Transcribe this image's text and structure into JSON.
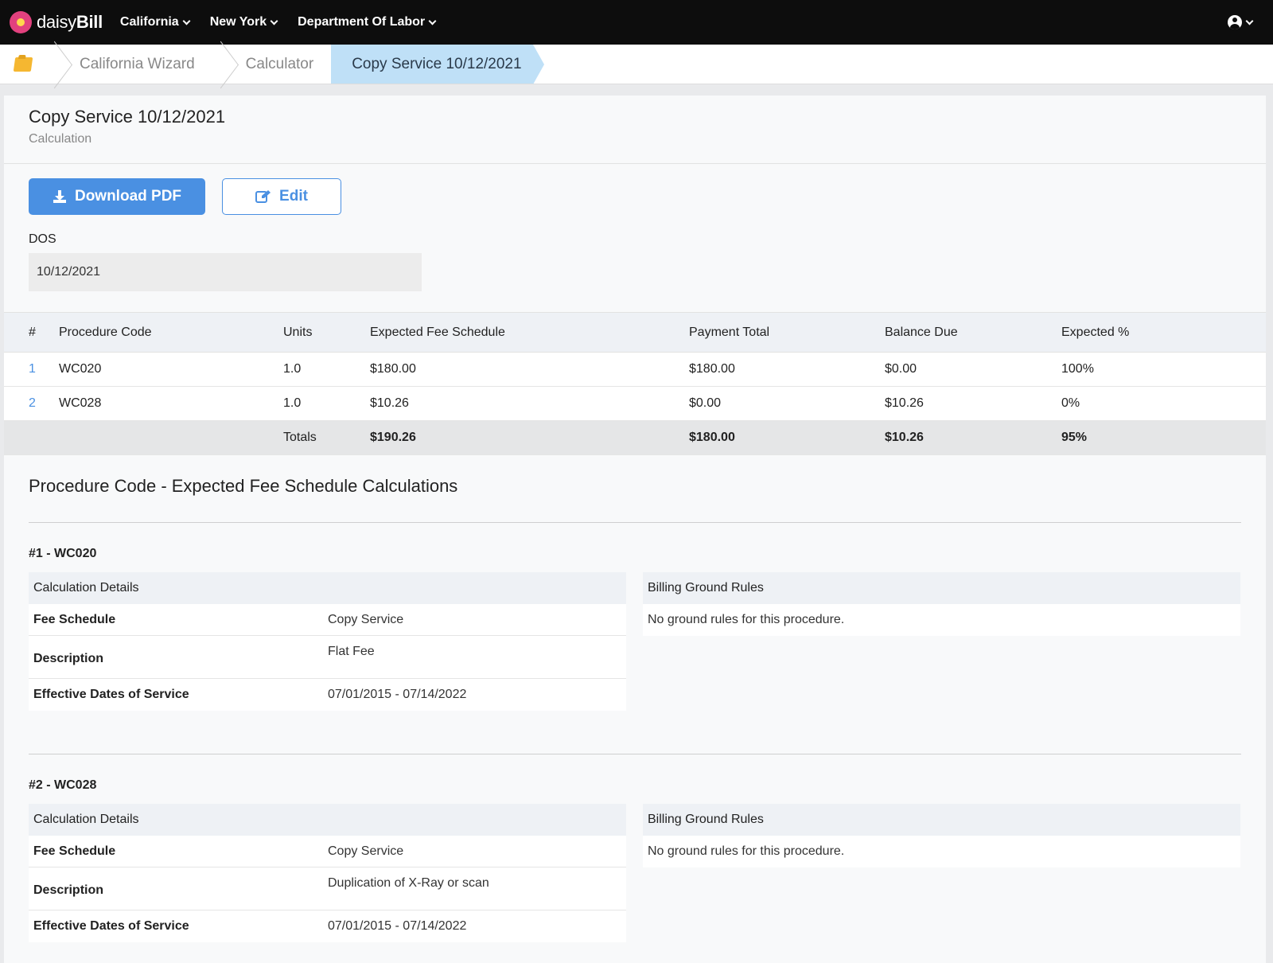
{
  "nav": {
    "logo_prefix": "daisy",
    "logo_bold": "Bill",
    "items": [
      "California",
      "New York",
      "Department Of Labor"
    ]
  },
  "breadcrumb": {
    "items": [
      "California Wizard",
      "Calculator",
      "Copy Service 10/12/2021"
    ]
  },
  "header": {
    "title": "Copy Service 10/12/2021",
    "subtitle": "Calculation"
  },
  "actions": {
    "download_label": "Download PDF",
    "edit_label": "Edit"
  },
  "dos": {
    "label": "DOS",
    "value": "10/12/2021"
  },
  "table": {
    "headers": [
      "#",
      "Procedure Code",
      "Units",
      "Expected Fee Schedule",
      "Payment Total",
      "Balance Due",
      "Expected %"
    ],
    "rows": [
      [
        "1",
        "WC020",
        "1.0",
        "$180.00",
        "$180.00",
        "$0.00",
        "100%"
      ],
      [
        "2",
        "WC028",
        "1.0",
        "$10.26",
        "$0.00",
        "$10.26",
        "0%"
      ]
    ],
    "totals": {
      "label": "Totals",
      "expected": "$190.26",
      "payment": "$180.00",
      "balance": "$10.26",
      "percent": "95%"
    }
  },
  "calc_section": {
    "title": "Procedure Code - Expected Fee Schedule Calculations",
    "details_header": "Calculation Details",
    "rules_header": "Billing Ground Rules",
    "fee_schedule_label": "Fee Schedule",
    "description_label": "Description",
    "effective_label": "Effective Dates of Service",
    "procedures": [
      {
        "title": "#1 - WC020",
        "fee_schedule": "Copy Service",
        "description": "Flat Fee",
        "effective": "07/01/2015 - 07/14/2022",
        "rules": "No ground rules for this procedure."
      },
      {
        "title": "#2 - WC028",
        "fee_schedule": "Copy Service",
        "description": "Duplication of X-Ray or scan",
        "effective": "07/01/2015 - 07/14/2022",
        "rules": "No ground rules for this procedure."
      }
    ]
  },
  "colors": {
    "primary": "#4a90e2",
    "topbar": "#0d0d0d",
    "breadcrumb_active": "#bfe0f7"
  }
}
